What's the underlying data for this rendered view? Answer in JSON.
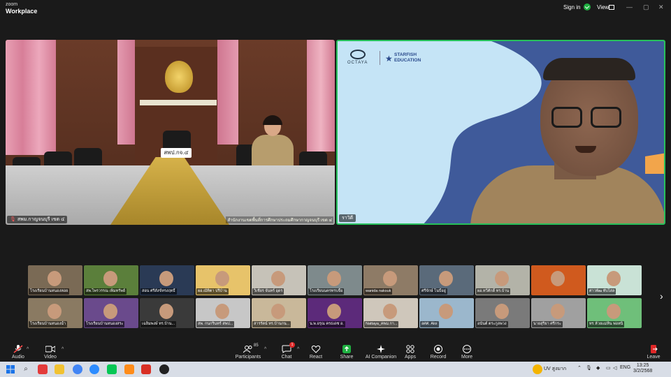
{
  "app": {
    "brand_small": "zoom",
    "brand_big": "Workplace"
  },
  "topbar": {
    "signin_label": "Sign in",
    "view_label": "View",
    "security_icon": "shield-check-icon",
    "view_icon": "grid-view-icon"
  },
  "main_videos": [
    {
      "name_label": "สพม.กาญจนบุรี เขต ๔",
      "nameplate": "สพป.กจ.๔",
      "caption": "สำนักงานเขตพื้นที่การศึกษาประถมศึกษากาญจนบุรี เขต ๔"
    },
    {
      "name_label": "ราวิดี",
      "logo_left": "OCTAYA",
      "logo_right_line1": "STARFISH",
      "logo_right_line2": "EDUCATION",
      "active_speaker_color": "#27c15b"
    }
  ],
  "thumbnails": [
    {
      "label": "โรงเรียนบ้านหนองหอย",
      "color": "#7a6a55"
    },
    {
      "label": "สพ.ไพรวรรณ เพิ่มทรัพย์",
      "color": "#5b7f3b"
    },
    {
      "label": "สอน ศรีสังข์ทรงฤทธิ์",
      "color": "#2a3a55"
    },
    {
      "label": "ผอ.ณัทิตา ปรีบ้าน",
      "color": "#e7c36a"
    },
    {
      "label": "วิเชียร จันทร์ อุดร",
      "color": "#c6c2b8"
    },
    {
      "label": "โรงเรียนนครทรบจื้อ",
      "color": "#7e8a8c"
    },
    {
      "label": "wanida naksuk",
      "color": "#8e7b66"
    },
    {
      "label": "ศรีจักษ์ โนบี้อยู่",
      "color": "#5a6a7a"
    },
    {
      "label": "ผอ.ทวีศักดิ์ ทร.บ้าน",
      "color": "#b3b3a8"
    },
    {
      "label": "",
      "color": "#d05a1e"
    },
    {
      "label": "ศาวพัฒ ทับไสล",
      "color": "#c9e2d6"
    },
    {
      "label": "โรงเรียนบ้านหนองน้ำ",
      "color": "#8a7a62"
    },
    {
      "label": "โรงเรียนบ้านหนองสระ",
      "color": "#6a4a8c"
    },
    {
      "label": "เฉลิมพงษ์ ทร.บ้าน...",
      "color": "#3a3a3a"
    },
    {
      "label": "สพ. กนกรินทร์ สพป...",
      "color": "#c7c7c7"
    },
    {
      "label": "สารรัตน์ ทร.บ้านกน...",
      "color": "#c9b89a"
    },
    {
      "label": "น.พ.อรุณ ครธเดช อ.",
      "color": "#5c2a7a"
    },
    {
      "label": "Nattaya_คพม.กา...",
      "color": "#cfc7bb"
    },
    {
      "label": "อศศ. Aloi",
      "color": "#9bb7cc"
    },
    {
      "label": "อนันต์ ตระกูลพวง",
      "color": "#7a7a7a"
    },
    {
      "label": "นายสุริยา ศรีกระ",
      "color": "#a0a0a0"
    },
    {
      "label": "ทร.ห้วยแม่หิน พ่อหนิ",
      "color": "#6fbf7a"
    }
  ],
  "toolbar": {
    "audio": "Audio",
    "video": "Video",
    "participants": "Participants",
    "participants_count": "85",
    "chat": "Chat",
    "chat_badge": "1",
    "react": "React",
    "share": "Share",
    "ai_companion": "AI Companion",
    "apps": "Apps",
    "record": "Record",
    "more": "More",
    "leave": "Leave",
    "share_color": "#1fb141",
    "leave_color": "#e02828"
  },
  "taskbar": {
    "weather": "UV สูงมาก",
    "lang": "ENG",
    "time": "13:25",
    "date": "3/2/2568"
  }
}
